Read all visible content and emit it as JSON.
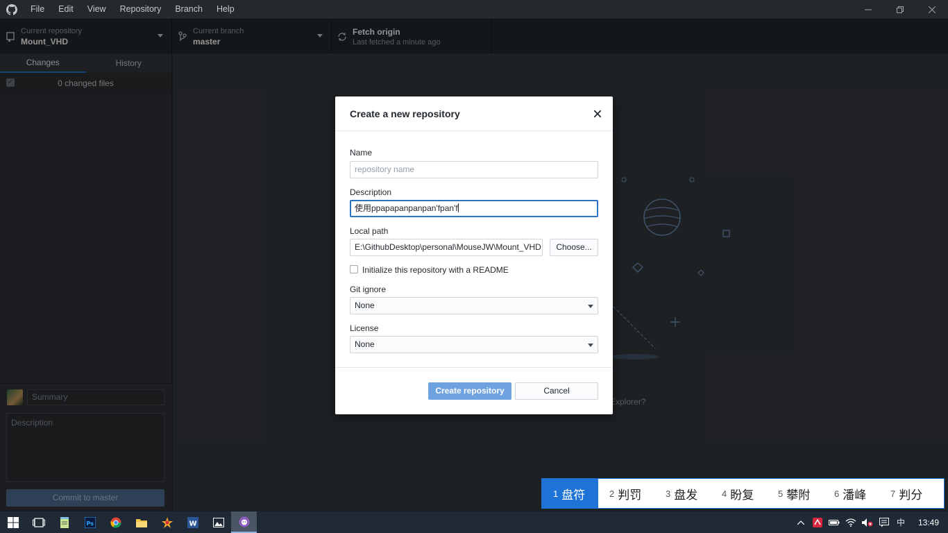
{
  "menu": [
    "File",
    "Edit",
    "View",
    "Repository",
    "Branch",
    "Help"
  ],
  "toolbar": {
    "repo_desc": "Current repository",
    "repo_title": "Mount_VHD",
    "branch_desc": "Current branch",
    "branch_title": "master",
    "fetch_title": "Fetch origin",
    "fetch_desc": "Last fetched a minute ago"
  },
  "sidebar": {
    "tabs": [
      "Changes",
      "History"
    ],
    "changed_files": "0 changed files",
    "summary_placeholder": "Summary",
    "description_placeholder": "Description",
    "commit_label": "Commit to master"
  },
  "main": {
    "hint_partial": "n Explorer?"
  },
  "dialog": {
    "title": "Create a new repository",
    "name_label": "Name",
    "name_placeholder": "repository name",
    "description_label": "Description",
    "description_value": "使用ppapapanpanpan'fpan'f",
    "local_path_label": "Local path",
    "local_path_value": "E:\\GithubDesktop\\personal\\MouseJW\\Mount_VHD",
    "choose_label": "Choose...",
    "readme_label": "Initialize this repository with a README",
    "gitignore_label": "Git ignore",
    "gitignore_value": "None",
    "license_label": "License",
    "license_value": "None",
    "create_label": "Create repository",
    "cancel_label": "Cancel"
  },
  "ime": {
    "candidates": [
      {
        "num": "1",
        "text": "盘符"
      },
      {
        "num": "2",
        "text": "判罚"
      },
      {
        "num": "3",
        "text": "盘发"
      },
      {
        "num": "4",
        "text": "盼复"
      },
      {
        "num": "5",
        "text": "攀附"
      },
      {
        "num": "6",
        "text": "潘峰"
      },
      {
        "num": "7",
        "text": "判分"
      }
    ]
  },
  "taskbar": {
    "ime_mode": "中",
    "clock": "13:49"
  },
  "colors": {
    "accent": "#2a74c6",
    "primary_button": "#6ea2e0",
    "chrome": "#24292e"
  }
}
